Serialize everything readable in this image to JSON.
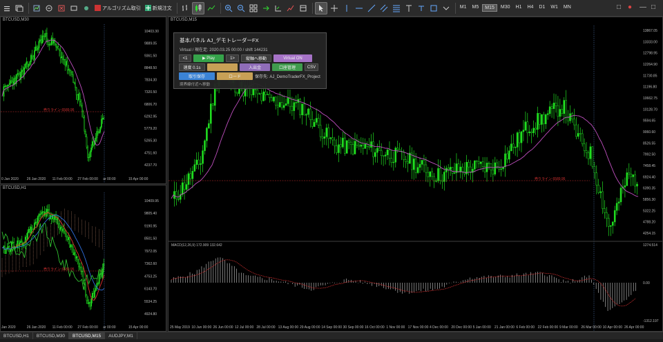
{
  "toolbar": {
    "algo_label": "アルゴリズム取引",
    "new_order_label": "新規注文",
    "timeframes": [
      "M1",
      "M5",
      "M15",
      "M30",
      "H1",
      "H4",
      "D1",
      "W1",
      "MN"
    ],
    "active_timeframe": "M15"
  },
  "left_top": {
    "title": "BTCUSD,M30",
    "price_labels": [
      "10403.30",
      "9889.05",
      "9361.50",
      "8848.50",
      "7834.30",
      "7320.50",
      "6806.70",
      "6292.95",
      "5779.20",
      "5265.30",
      "4751.60",
      "4237.70"
    ],
    "time_labels": [
      "0 Jan 2020",
      "26 Jan 2020",
      "11 Feb 00:00",
      "27 Feb 00:00",
      "ar 00:00",
      "15 Apr 00:00"
    ],
    "hline_label": "売りライン 6589.95"
  },
  "left_bottom": {
    "title": "BTCUSD,H1",
    "price_labels": [
      "10409.95",
      "9805.40",
      "9190.95",
      "8501.50",
      "7972.05",
      "7362.60",
      "4753.25",
      "6143.70",
      "5534.25",
      "4924.80"
    ],
    "time_labels": [
      "Jan 2020",
      "26 Jan 2020",
      "11 Feb 00:00",
      "27 Feb 00:00",
      "ar 00:00",
      "15 Apr 00:00"
    ],
    "hline_label": "売りライン 6589.95"
  },
  "main": {
    "title": "BTCUSD,M15",
    "price_labels": [
      "13867.05",
      "13333.00",
      "12798.95",
      "12264.90",
      "11730.85",
      "11196.80",
      "10662.75",
      "10128.70",
      "9594.65",
      "9060.60",
      "8526.55",
      "7992.50",
      "7458.45",
      "6924.40",
      "6390.35",
      "5856.30",
      "5322.25",
      "4788.20",
      "4254.15"
    ],
    "hline_label": "売りライン 6589.95",
    "macd_title": "MACD(12,26,9) 172.909 132.642",
    "macd_labels": [
      "1274.514",
      "0.00",
      "-1312.197"
    ],
    "time_labels": [
      "25 May 2019",
      "10 Jun 00:00",
      "26 Jun 00:00",
      "12 Jul 00:00",
      "28 Jul 00:00",
      "13 Aug 00:00",
      "29 Aug 00:00",
      "14 Sep 00:00",
      "30 Sep 00:00",
      "16 Oct 00:00",
      "1 Nov 00:00",
      "17 Nov 00:00",
      "4 Dec 00:00",
      "20 Dec 00:00",
      "5 Jan 00:00",
      "21 Jan 00:00",
      "6 Feb 00:00",
      "22 Feb 00:00",
      "9 Mar 00:00",
      "26 Mar 00:00",
      "10 Apr 00:00",
      "26 Apr 00:00"
    ]
  },
  "panel": {
    "title": "基本パネル AJ_デモトレーダーFX",
    "subtitle": "Virtual / 現在足: 2020.03.25 00:00 / shift 144231",
    "row1": [
      "<1",
      "1>",
      "縦軸へ移動",
      "Virtual ON"
    ],
    "row1_play": "▶ Play",
    "row2": [
      "速度 0.1s",
      "",
      "入出金",
      "口座管理",
      "CSV"
    ],
    "row3_save": "保存先: AJ_DemoTraderFX_Project",
    "row3_btns": [
      "取引保存",
      "ロード"
    ],
    "note": "境界線付近へ移動"
  },
  "tabs": [
    "BTCUSD,H1",
    "BTCUSD,M30",
    "BTCUSD,M15",
    "AUDJPY,M1"
  ],
  "active_tab": "BTCUSD,M15",
  "colors": {
    "candle": "#20e020",
    "ma": "#c050c0",
    "sell_line": "#d03030",
    "macd_signal": "#d03030",
    "macd_hist": "#cfcfcf"
  }
}
